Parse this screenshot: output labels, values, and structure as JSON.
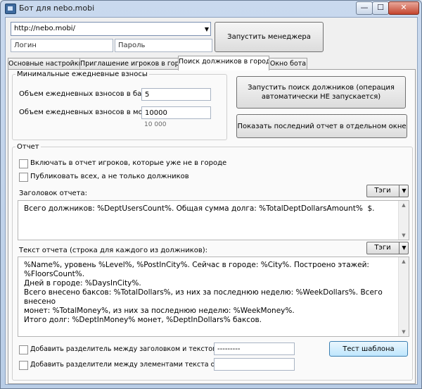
{
  "window": {
    "title": "Бот для nebo.mobi",
    "min_icon": "minimize-icon",
    "max_icon": "maximize-icon",
    "close_icon": "close-icon",
    "min_glyph": "—",
    "max_glyph": "☐",
    "close_glyph": "✕"
  },
  "top": {
    "url_value": "http://nebo.mobi/",
    "login_placeholder": "Логин",
    "password_placeholder": "Пароль",
    "start_manager_label": "Запустить менеджера"
  },
  "tabs": [
    {
      "label": "Основные настройки"
    },
    {
      "label": "Приглашение игроков в город"
    },
    {
      "label": "Поиск должников в городе"
    },
    {
      "label": "Окно бота"
    }
  ],
  "active_tab": 2,
  "contrib": {
    "group_label": "Минимальные ежедневные взносы",
    "bucks_label": "Объем ежедневных взносов в баксах:",
    "bucks_value": "5",
    "coins_label": "Объем ежедневных взносов в монетах:",
    "coins_value": "10000",
    "coins_hint": "10 000"
  },
  "actions": {
    "start_search_label": "Запустить поиск должников (операция автоматически НЕ запускается)",
    "show_report_label": "Показать последний отчет в отдельном окне"
  },
  "report": {
    "group_label": "Отчет",
    "include_left_label": "Включать в отчет игроков, которые уже не в городе",
    "include_left_checked": false,
    "publish_all_label": "Публиковать всех, а не только должников",
    "publish_all_checked": false,
    "header_label": "Заголовок отчета:",
    "tags_label": "Тэги",
    "header_text": "Всего должников: %DeptUsersCount%. Общая сумма долга: %TotalDeptDollarsAmount%  $.",
    "body_label": "Текст отчета (строка для каждого из должников):",
    "body_text": "%Name%, уровень %Level%, %PostInCity%. Сейчас в городе: %City%. Построено этажей: %FloorsCount%.\nДней в городе: %DaysInCity%.\nВсего внесено баксов: %TotalDollars%, из них за последнюю неделю: %WeekDollars%. Всего внесено\nмонет: %TotalMoney%, из них за последнюю неделю: %WeekMoney%.\nИтого долг: %DeptInMoney% монет, %DeptInDollars% баксов.",
    "sep_header_label": "Добавить разделитель между заголовком и текстом отчета",
    "sep_header_checked": false,
    "sep_header_value": "---------",
    "sep_items_label": "Добавить разделители между элементами текста отчета",
    "sep_items_checked": false,
    "sep_items_value": "",
    "test_template_label": "Тест шаблона"
  }
}
